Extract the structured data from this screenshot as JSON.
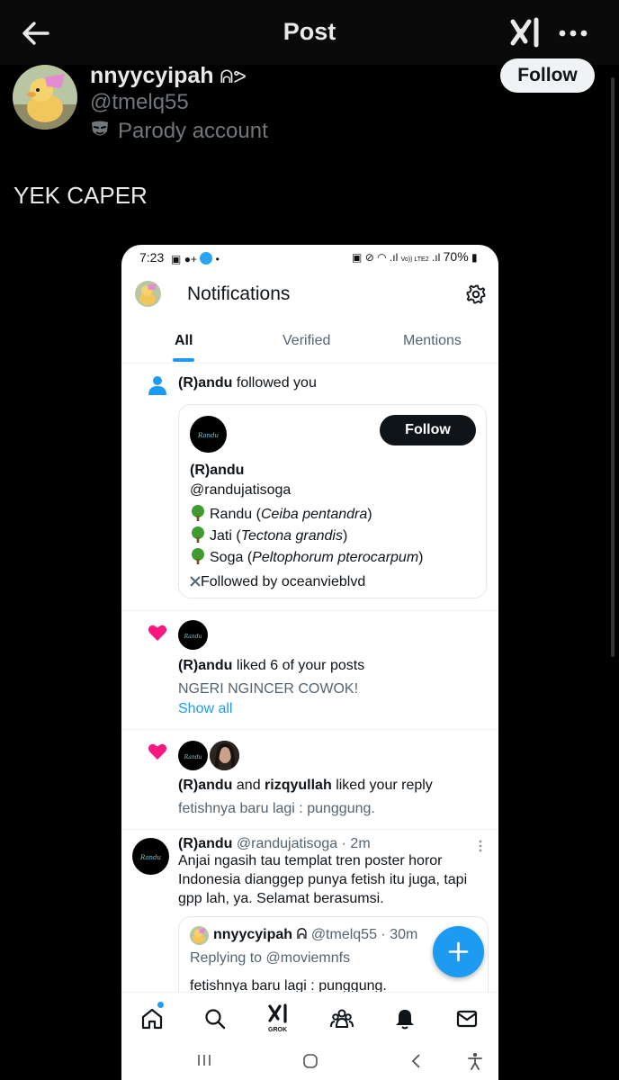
{
  "header": {
    "title": "Post"
  },
  "post": {
    "author_name": "nnyycyipah",
    "author_symbol": "ᕱᕗ",
    "author_handle": "@tmelq55",
    "parody_label": "Parody account",
    "follow_label": "Follow",
    "text": "YEK CAPER"
  },
  "screenshot": {
    "status": {
      "time": "7:23",
      "battery": "70%",
      "network": "Vo)) LTE2"
    },
    "page_title": "Notifications",
    "tabs": [
      {
        "label": "All",
        "active": true
      },
      {
        "label": "Verified",
        "active": false
      },
      {
        "label": "Mentions",
        "active": false
      }
    ],
    "follow_notification": {
      "actor": "(R)andu",
      "action": "followed you",
      "card": {
        "avatar_text": "Randu",
        "follow_label": "Follow",
        "name": "(R)andu",
        "handle": "@randujatisoga",
        "bio": [
          {
            "common": "Randu",
            "latin": "Ceiba pentandra"
          },
          {
            "common": "Jati",
            "latin": "Tectona grandis"
          },
          {
            "common": "Soga",
            "latin": "Peltophorum pterocarpum"
          }
        ],
        "followed_by": "Followed by oceanvieblvd"
      }
    },
    "like_notification": {
      "actor": "(R)andu",
      "action": "liked 6 of your posts",
      "preview": "NGERI NGINCER COWOK!",
      "show_all": "Show all"
    },
    "reply_like_notification": {
      "actor_1": "(R)andu",
      "joiner": "and",
      "actor_2": "rizqyullah",
      "action": "liked your reply",
      "preview": "fetishnya baru lagi : punggung."
    },
    "tweet": {
      "name": "(R)andu",
      "handle_time": "@randujatisoga · 2m",
      "text": "Anjai ngasih tau templat tren poster horor Indonesia dianggep punya fetish itu juga, tapi gpp lah, ya. Selamat berasumsi.",
      "quote": {
        "name": "nnyycyipah",
        "symbol": "ᕱ",
        "handle_time": "@tmelq55 · 30m",
        "replying": "Replying to @moviemnfs",
        "text": "fetishnya baru lagi : punggung."
      }
    },
    "bottom_nav": {
      "grok_label": "GROK",
      "items": [
        "home-icon",
        "search-icon",
        "grok-icon",
        "communities-icon",
        "bell-icon",
        "mail-icon"
      ]
    },
    "system_nav": [
      "recent-apps-icon",
      "home-circle-icon",
      "back-chevron-icon",
      "accessibility-icon"
    ]
  },
  "colors": {
    "background": "#000000",
    "accent_blue": "#1d9bf0",
    "like_pink": "#f91880",
    "muted_gray": "#71767b"
  }
}
